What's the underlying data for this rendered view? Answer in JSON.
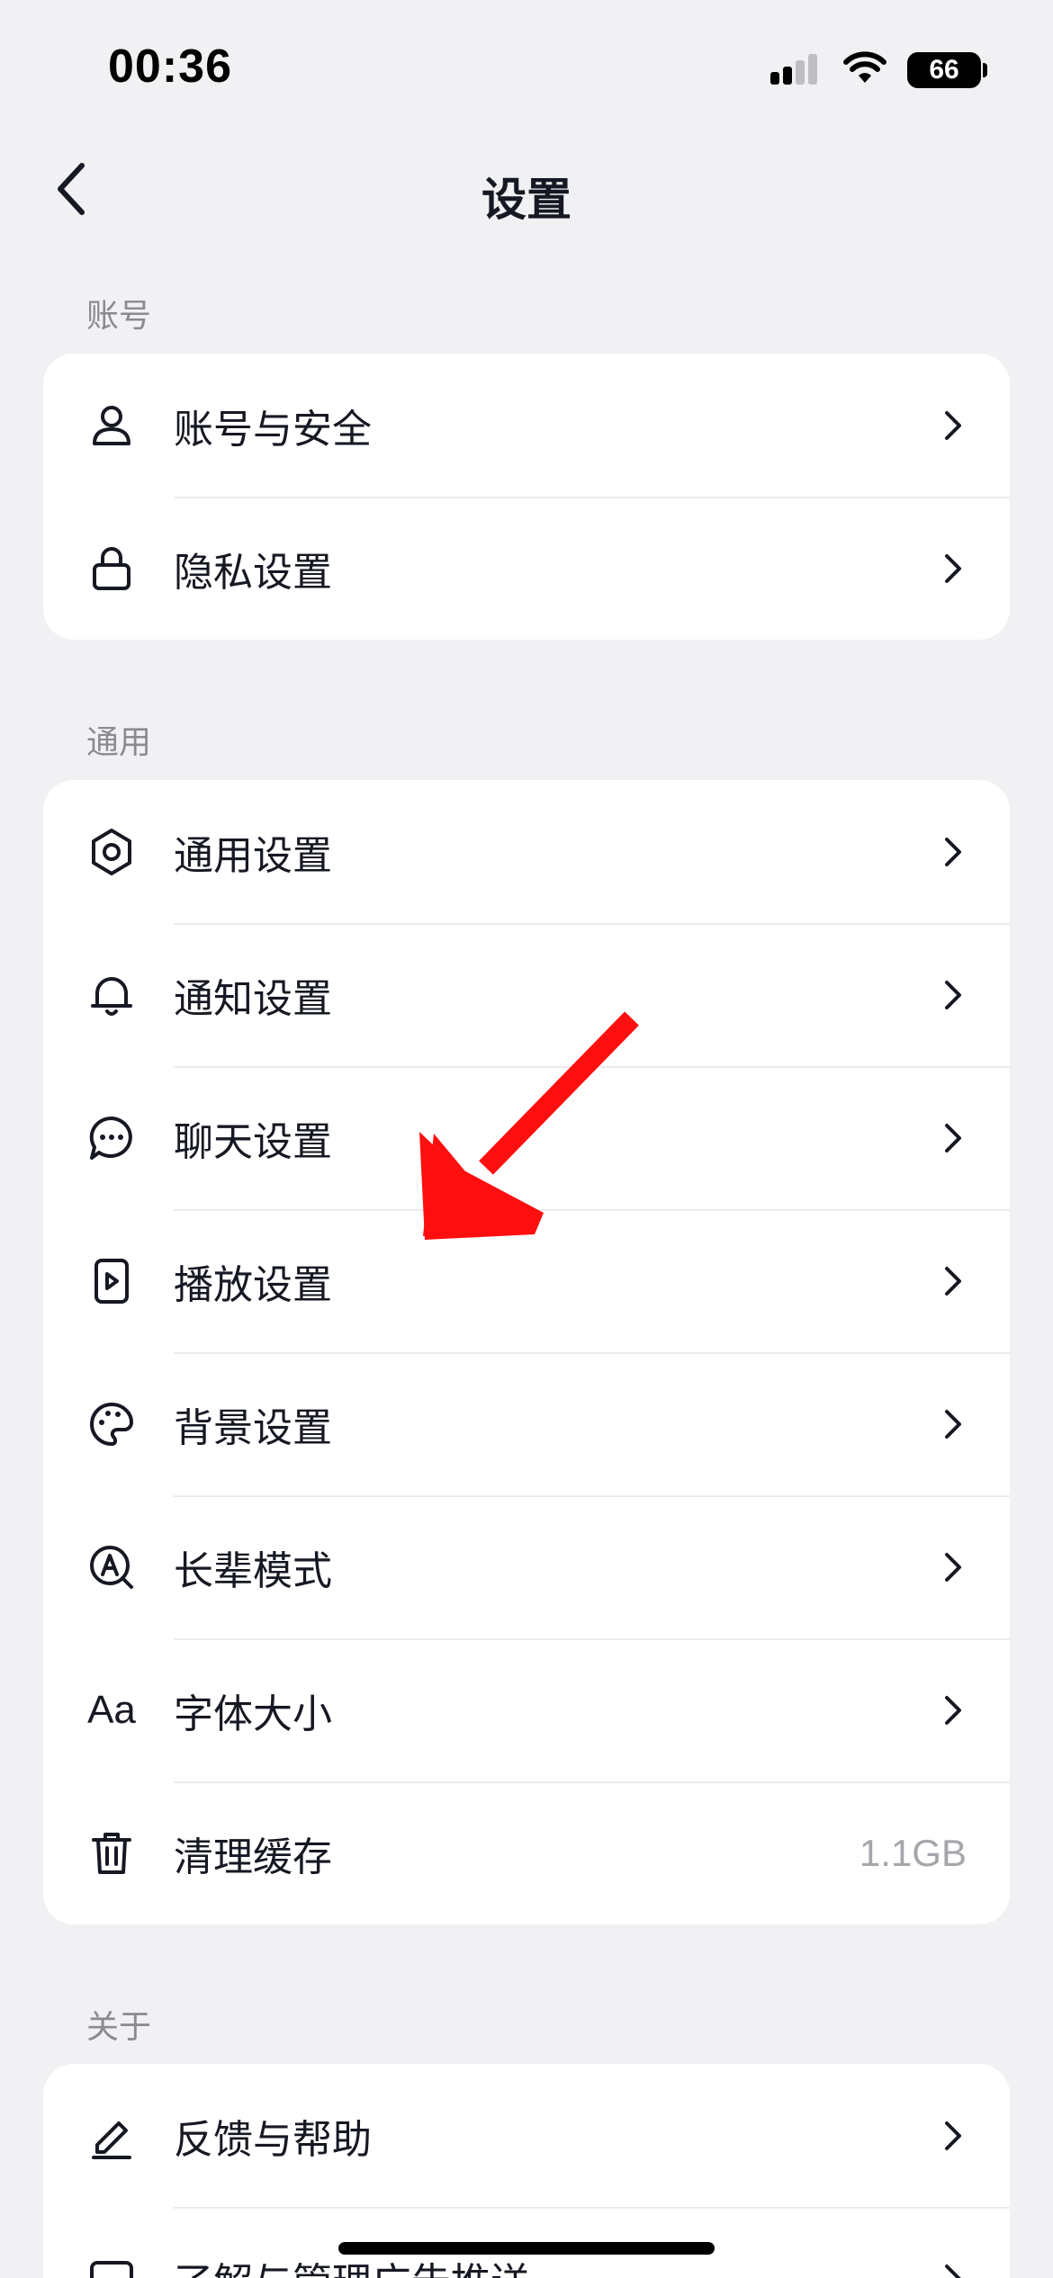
{
  "status_bar": {
    "time": "00:36",
    "battery": "66"
  },
  "nav": {
    "title": "设置"
  },
  "sections": {
    "account": {
      "label": "账号",
      "items": [
        {
          "label": "账号与安全"
        },
        {
          "label": "隐私设置"
        }
      ]
    },
    "general": {
      "label": "通用",
      "items": [
        {
          "label": "通用设置"
        },
        {
          "label": "通知设置"
        },
        {
          "label": "聊天设置"
        },
        {
          "label": "播放设置"
        },
        {
          "label": "背景设置"
        },
        {
          "label": "长辈模式"
        },
        {
          "label": "字体大小",
          "icon_text": "Aa"
        },
        {
          "label": "清理缓存",
          "value": "1.1GB"
        }
      ]
    },
    "about": {
      "label": "关于",
      "items": [
        {
          "label": "反馈与帮助"
        },
        {
          "label": "了解与管理广告推送"
        }
      ]
    }
  },
  "colors": {
    "background": "#f1f1f4",
    "card": "#ffffff",
    "text": "#161823",
    "muted": "#8a8b91",
    "annotation": "#fe0f0f"
  }
}
